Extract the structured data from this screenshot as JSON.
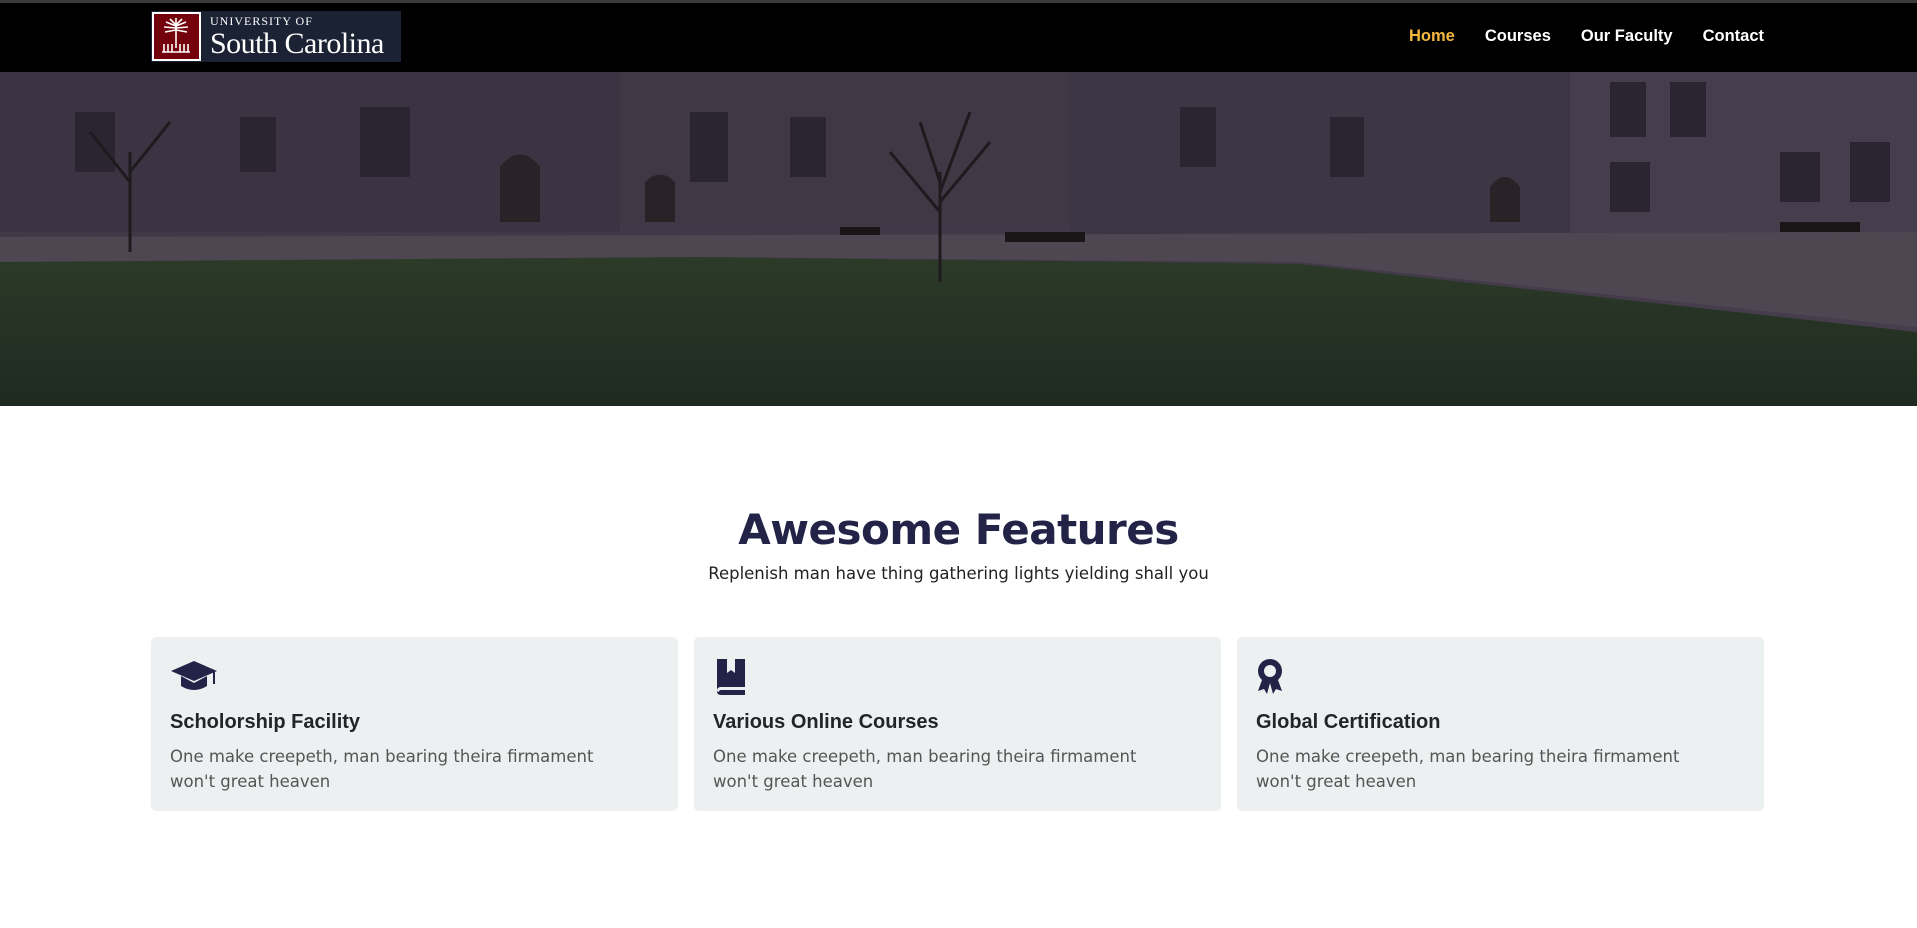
{
  "logo": {
    "line1": "UNIVERSITY OF",
    "line2": "South Carolina",
    "mark_color": "#73000a"
  },
  "nav": {
    "items": [
      {
        "label": "Home",
        "active": true
      },
      {
        "label": "Courses",
        "active": false
      },
      {
        "label": "Our Faculty",
        "active": false
      },
      {
        "label": "Contact",
        "active": false
      }
    ],
    "active_color": "#f5b83c"
  },
  "hero": {
    "image": "university-courtyard-photo"
  },
  "features": {
    "title": "Awesome Features",
    "subtitle": "Replenish man have thing gathering lights yielding shall you",
    "cards": [
      {
        "icon": "graduation-cap-icon",
        "title": "Scholorship Facility",
        "text": "One make creepeth, man bearing theira firmament won't great heaven"
      },
      {
        "icon": "book-icon",
        "title": "Various Online Courses",
        "text": "One make creepeth, man bearing theira firmament won't great heaven"
      },
      {
        "icon": "award-icon",
        "title": "Global Certification",
        "text": "One make creepeth, man bearing theira firmament won't great heaven"
      }
    ]
  },
  "colors": {
    "header_bg": "#000000",
    "title": "#232348",
    "card_bg": "#edf0f1"
  }
}
